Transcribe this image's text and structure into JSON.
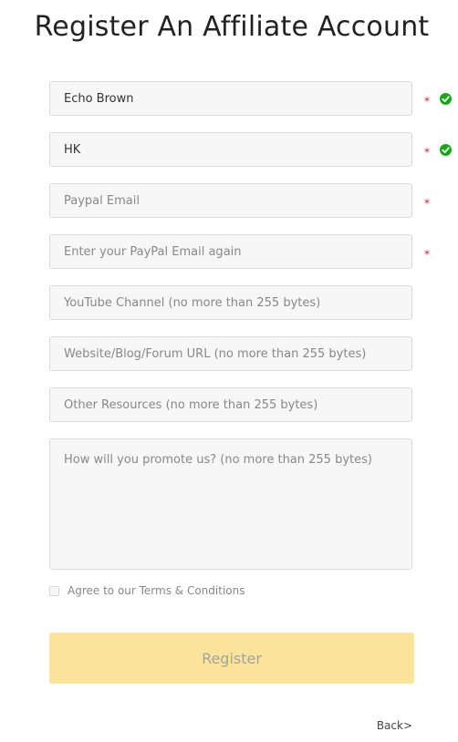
{
  "page": {
    "title": "Register An Affiliate Account"
  },
  "form": {
    "name": {
      "value": "Echo Brown",
      "required_mark": "*"
    },
    "region": {
      "value": "HK",
      "required_mark": "*"
    },
    "paypal_email": {
      "placeholder": "Paypal Email",
      "required_mark": "*"
    },
    "paypal_email_confirm": {
      "placeholder": "Enter your PayPal Email again",
      "required_mark": "*"
    },
    "youtube_channel": {
      "placeholder": "YouTube Channel (no more than 255 bytes)"
    },
    "website_url": {
      "placeholder": "Website/Blog/Forum URL (no more than 255 bytes)"
    },
    "other_resources": {
      "placeholder": "Other Resources (no more than 255 bytes)"
    },
    "promotion": {
      "placeholder": "How will you promote us? (no more than 255 bytes)"
    },
    "agree_label": "Agree to our Terms & Conditions",
    "register_label": "Register",
    "back_label": "Back>"
  },
  "icons": {
    "valid": "check-circle-icon"
  },
  "colors": {
    "required": "#e02020",
    "valid": "#1aa51a",
    "register_button_bg": "#fae39b",
    "register_button_text": "#a3a3a3"
  }
}
